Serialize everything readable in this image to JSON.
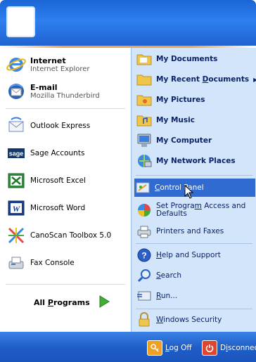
{
  "left": {
    "pinned": [
      {
        "title": "Internet",
        "subtitle": "Internet Explorer",
        "icon": "internet-explorer-icon"
      },
      {
        "title": "E-mail",
        "subtitle": "Mozilla Thunderbird",
        "icon": "thunderbird-icon"
      }
    ],
    "recent": [
      {
        "label": "Outlook Express",
        "icon": "outlook-express-icon"
      },
      {
        "label": "Sage Accounts",
        "icon": "sage-icon"
      },
      {
        "label": "Microsoft Excel",
        "icon": "excel-icon"
      },
      {
        "label": "Microsoft Word",
        "icon": "word-icon"
      },
      {
        "label": "CanoScan Toolbox 5.0",
        "icon": "canoscan-icon"
      },
      {
        "label": "Fax Console",
        "icon": "fax-icon"
      }
    ],
    "all_programs": {
      "pre": "All ",
      "u": "P",
      "post": "rograms"
    }
  },
  "right": {
    "my_documents": "My Documents",
    "recent_docs": {
      "pre": "My Recent ",
      "u": "D",
      "post": "ocuments"
    },
    "my_pictures": "My Pictures",
    "my_music": "My Music",
    "my_computer": "My Computer",
    "network_places": "My Network Places",
    "control_panel": {
      "u": "C",
      "post": "ontrol Panel"
    },
    "set_program": {
      "line1_pre": "Set Progra",
      "line1_u": "m",
      "line1_post": " Access and",
      "line2": "Defaults"
    },
    "printers": "Printers and Faxes",
    "help": {
      "u": "H",
      "post": "elp and Support"
    },
    "search": {
      "u": "S",
      "post": "earch"
    },
    "run": {
      "u": "R",
      "post": "un..."
    },
    "windows_security": {
      "u": "W",
      "post": "indows Security"
    }
  },
  "footer": {
    "logoff": {
      "u": "L",
      "post": "og Off"
    },
    "disconnect": {
      "pre": "D",
      "u": "i",
      "post": "sconnect"
    }
  },
  "colors": {
    "header": "#2e7ff0",
    "right_panel": "#d3e5fa",
    "selected": "#2f6bd0",
    "accent_line": "#f2a24a"
  }
}
